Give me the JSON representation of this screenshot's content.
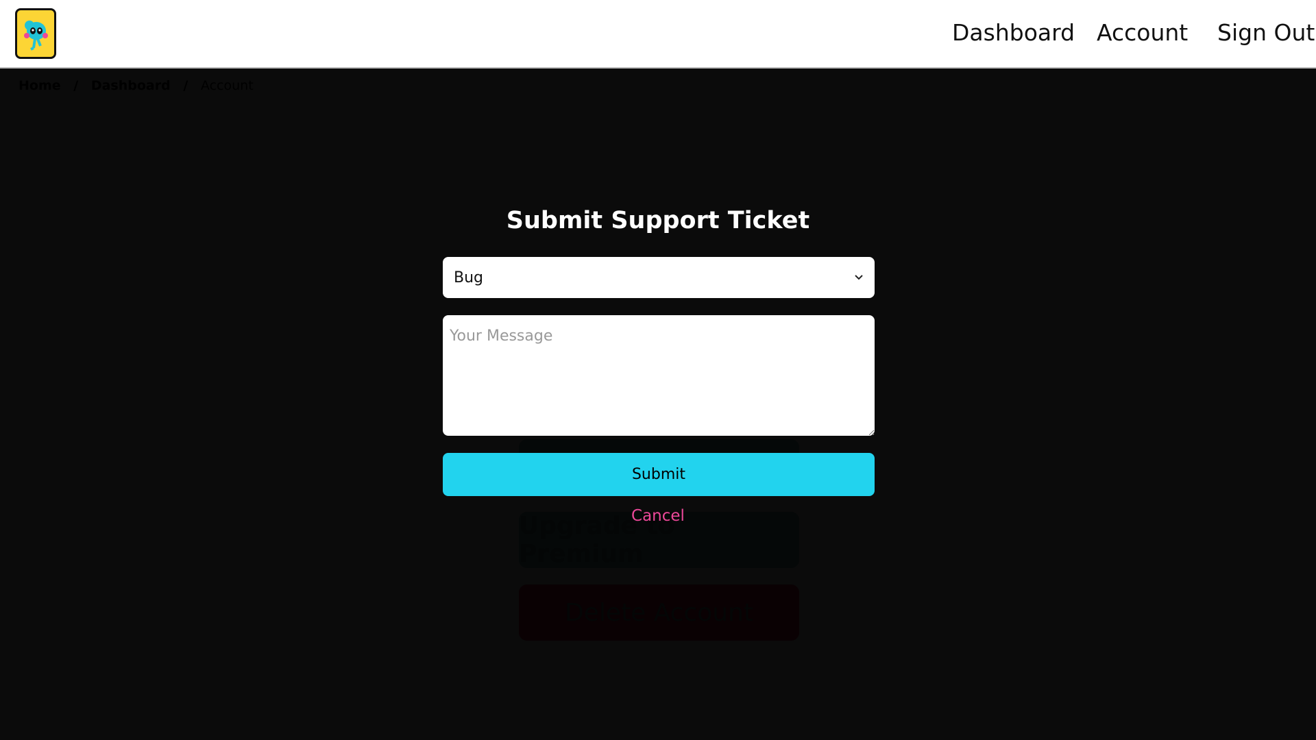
{
  "header": {
    "logo": "mascot-logo",
    "nav": [
      "Dashboard",
      "Account",
      "Sign Out"
    ]
  },
  "breadcrumb": [
    "Home",
    "/",
    "Dashboard",
    "/",
    "Account"
  ],
  "background_buttons": {
    "upgrade": "Upgrade to Premium",
    "delete": "Delete Account"
  },
  "modal": {
    "title": "Submit Support Ticket",
    "type_select": {
      "value": "Bug"
    },
    "message": {
      "placeholder": "Your Message",
      "value": ""
    },
    "submit_label": "Submit",
    "cancel_label": "Cancel"
  },
  "colors": {
    "accent": "#22d3ee",
    "cancel": "#ec4899",
    "logo_bg": "#fcd535"
  }
}
